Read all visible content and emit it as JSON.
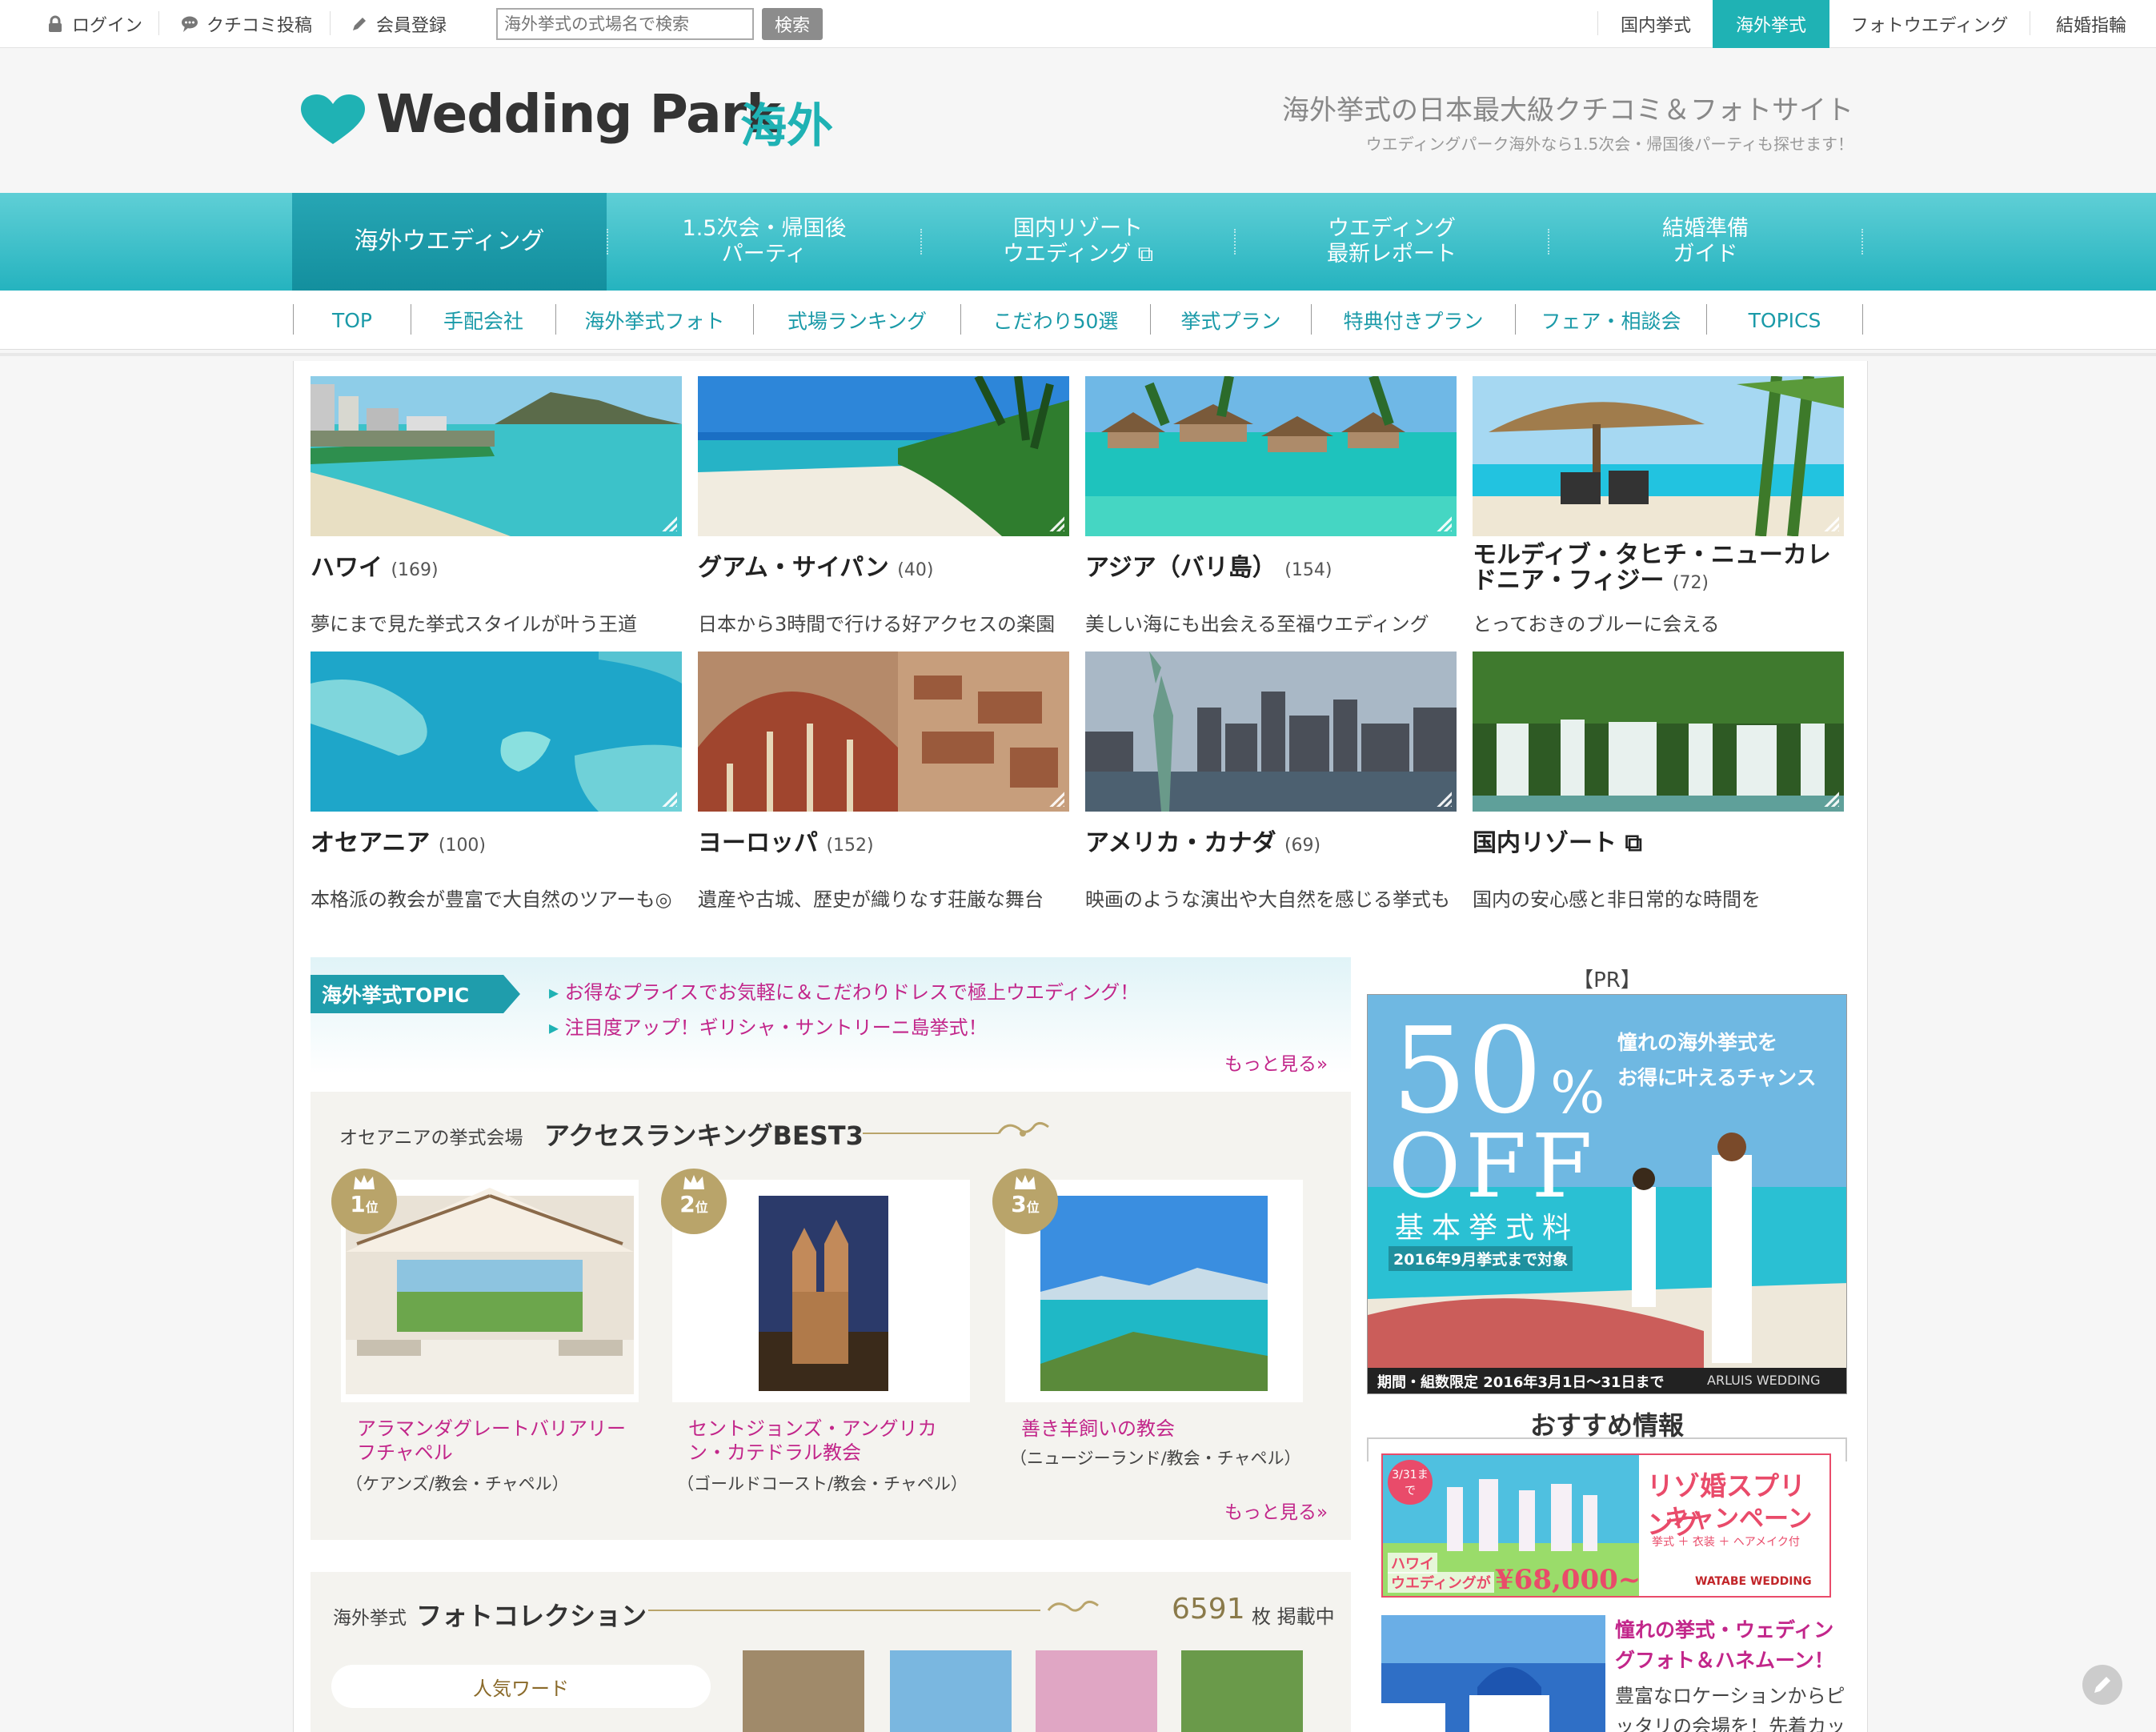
{
  "topbar": {
    "login": "ログイン",
    "review": "クチコミ投稿",
    "register": "会員登録",
    "search_placeholder": "海外挙式の式場名で検索",
    "search_button": "検索",
    "right_links": [
      "国内挙式",
      "海外挙式",
      "フォトウエディング",
      "結婚指輪"
    ]
  },
  "header": {
    "logo_text": "Wedding Park",
    "logo_suffix": "海外",
    "tagline": "海外挙式の日本最大級クチコミ＆フォトサイト",
    "subtagline": "ウエディングパーク海外なら1.5次会・帰国後パーティも探せます！"
  },
  "mainnav": {
    "items": [
      {
        "line1": "海外ウエディング",
        "line2": ""
      },
      {
        "line1": "1.5次会・帰国後",
        "line2": "パーティ"
      },
      {
        "line1": "国内リゾート",
        "line2": "ウエディング ⧉"
      },
      {
        "line1": "ウエディング",
        "line2": "最新レポート"
      },
      {
        "line1": "結婚準備",
        "line2": "ガイド"
      }
    ]
  },
  "subnav": {
    "items": [
      "TOP",
      "手配会社",
      "海外挙式フォト",
      "式場ランキング",
      "こだわり50選",
      "挙式プラン",
      "特典付きプラン",
      "フェア・相談会",
      "TOPICS"
    ]
  },
  "destinations": [
    {
      "name": "ハワイ",
      "count": "(169)",
      "desc": "夢にまで見た挙式スタイルが叶う王道"
    },
    {
      "name": "グアム・サイパン",
      "count": "(40)",
      "desc": "日本から3時間で行ける好アクセスの楽園"
    },
    {
      "name": "アジア（バリ島）",
      "count": "(154)",
      "desc": "美しい海にも出会える至福ウエディング"
    },
    {
      "name": "モルディブ・タヒチ・ニューカレドニア・フィジー",
      "count": "(72)",
      "desc": "とっておきのブルーに会える"
    },
    {
      "name": "オセアニア",
      "count": "(100)",
      "desc": "本格派の教会が豊富で大自然のツアーも◎"
    },
    {
      "name": "ヨーロッパ",
      "count": "(152)",
      "desc": "遺産や古城、歴史が織りなす荘厳な舞台"
    },
    {
      "name": "アメリカ・カナダ",
      "count": "(69)",
      "desc": "映画のような演出や大自然を感じる挙式も"
    },
    {
      "name": "国内リゾート ⧉",
      "count": "",
      "desc": "国内の安心感と非日常的な時間を"
    }
  ],
  "topic": {
    "label": "海外挙式TOPIC",
    "links": [
      "お得なプライスでお気軽に＆こだわりドレスで極上ウエディング！",
      "注目度アップ！ギリシャ・サントリーニ島挙式！"
    ],
    "more": "もっと見る»"
  },
  "ranking": {
    "prefix": "オセアニアの挙式会場",
    "title": "アクセスランキングBEST3",
    "items": [
      {
        "rank": "1",
        "unit": "位",
        "name": "アラマンダグレートバリアリーフチャペル",
        "sub": "（ケアンズ/教会・チャペル）"
      },
      {
        "rank": "2",
        "unit": "位",
        "name": "セントジョンズ・アングリカン・カテドラル教会",
        "sub": "（ゴールドコースト/教会・チャペル）"
      },
      {
        "rank": "3",
        "unit": "位",
        "name": "善き羊飼いの教会",
        "sub": "（ニュージーランド/教会・チャペル）"
      }
    ],
    "more": "もっと見る»"
  },
  "photos": {
    "prefix": "海外挙式",
    "title": "フォトコレクション",
    "count": "6591",
    "count_suffix": "枚 掲載中",
    "popular_word": "人気ワード"
  },
  "sidebar": {
    "pr": "【PR】",
    "banner": {
      "big": "50",
      "pct": "%",
      "off": "OFF",
      "kihon": "基本挙式料",
      "line1": "憧れの海外挙式を",
      "line2": "お得に叶えるチャンス",
      "note": "2016年9月挙式まで対象",
      "footer": "期間・組数限定 2016年3月1日〜31日まで",
      "brand": "ARLUIS WEDDING"
    },
    "osusume": "おすすめ情報",
    "rec1": {
      "tag": "3/31まで",
      "title1": "リゾ婚スプリング",
      "title2": "キャンペーン",
      "sub": "挙式 ＋ 衣装 ＋ ヘアメイク付",
      "hawaii": "ハワイ",
      "price_pre": "ウエディングが",
      "price": "¥68,000~",
      "brand": "WATABE WEDDING"
    },
    "rec2": {
      "title": "憧れの挙式・ウェディングフォト＆ハネムーン！",
      "desc": "豊富なロケーションからピッタリの会場を！先着カッ"
    }
  }
}
